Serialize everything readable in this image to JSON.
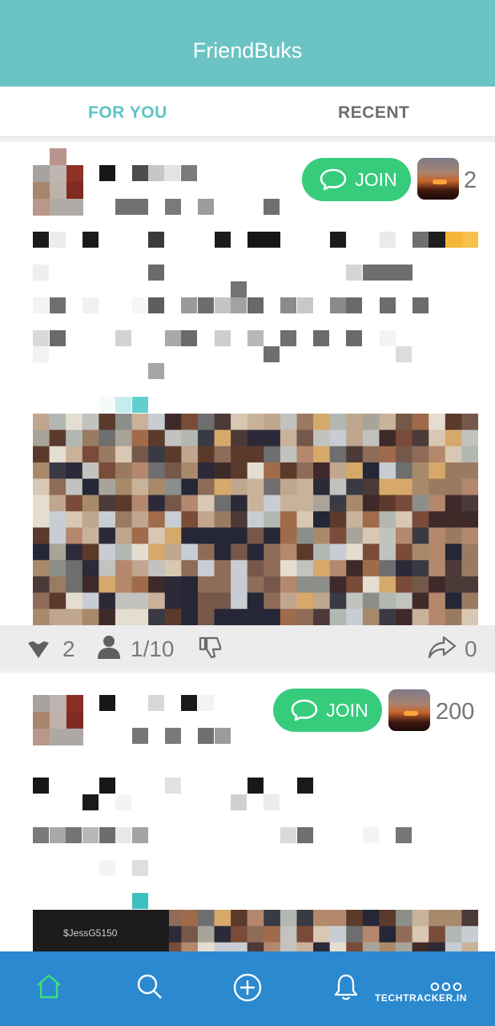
{
  "app": {
    "title": "FriendBuks"
  },
  "tabs": [
    {
      "label": "FOR YOU"
    },
    {
      "label": "RECENT"
    }
  ],
  "colors": {
    "header": "#6cc3c4",
    "accent": "#5cc4c6",
    "join": "#36cc7c",
    "nav": "#2b89cf"
  },
  "posts": [
    {
      "join_label": "JOIN",
      "member_count": "2",
      "stats": {
        "likes": "2",
        "members": "1/10",
        "shares": "0"
      }
    },
    {
      "join_label": "JOIN",
      "member_count": "200",
      "image_caption": "$JessG5150"
    }
  ],
  "nav": {
    "items": [
      "home-icon",
      "search-icon",
      "add-icon",
      "bell-icon",
      "more-icon"
    ]
  },
  "watermark": "TECHTRACKER.IN"
}
